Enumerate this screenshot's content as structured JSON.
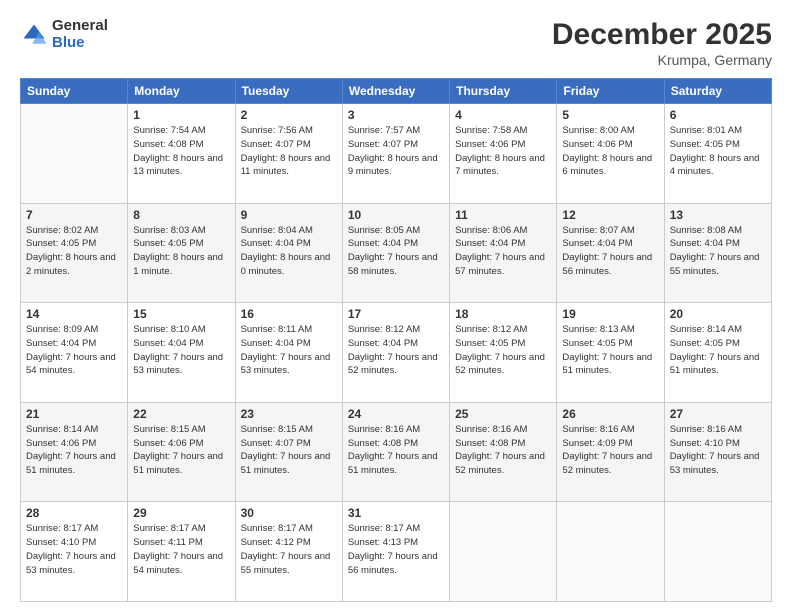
{
  "logo": {
    "general": "General",
    "blue": "Blue"
  },
  "header": {
    "month": "December 2025",
    "location": "Krumpa, Germany"
  },
  "weekdays": [
    "Sunday",
    "Monday",
    "Tuesday",
    "Wednesday",
    "Thursday",
    "Friday",
    "Saturday"
  ],
  "weeks": [
    [
      {
        "day": "",
        "empty": true
      },
      {
        "day": "1",
        "sunrise": "7:54 AM",
        "sunset": "4:08 PM",
        "daylight": "8 hours and 13 minutes."
      },
      {
        "day": "2",
        "sunrise": "7:56 AM",
        "sunset": "4:07 PM",
        "daylight": "8 hours and 11 minutes."
      },
      {
        "day": "3",
        "sunrise": "7:57 AM",
        "sunset": "4:07 PM",
        "daylight": "8 hours and 9 minutes."
      },
      {
        "day": "4",
        "sunrise": "7:58 AM",
        "sunset": "4:06 PM",
        "daylight": "8 hours and 7 minutes."
      },
      {
        "day": "5",
        "sunrise": "8:00 AM",
        "sunset": "4:06 PM",
        "daylight": "8 hours and 6 minutes."
      },
      {
        "day": "6",
        "sunrise": "8:01 AM",
        "sunset": "4:05 PM",
        "daylight": "8 hours and 4 minutes."
      }
    ],
    [
      {
        "day": "7",
        "sunrise": "8:02 AM",
        "sunset": "4:05 PM",
        "daylight": "8 hours and 2 minutes."
      },
      {
        "day": "8",
        "sunrise": "8:03 AM",
        "sunset": "4:05 PM",
        "daylight": "8 hours and 1 minute."
      },
      {
        "day": "9",
        "sunrise": "8:04 AM",
        "sunset": "4:04 PM",
        "daylight": "8 hours and 0 minutes."
      },
      {
        "day": "10",
        "sunrise": "8:05 AM",
        "sunset": "4:04 PM",
        "daylight": "7 hours and 58 minutes."
      },
      {
        "day": "11",
        "sunrise": "8:06 AM",
        "sunset": "4:04 PM",
        "daylight": "7 hours and 57 minutes."
      },
      {
        "day": "12",
        "sunrise": "8:07 AM",
        "sunset": "4:04 PM",
        "daylight": "7 hours and 56 minutes."
      },
      {
        "day": "13",
        "sunrise": "8:08 AM",
        "sunset": "4:04 PM",
        "daylight": "7 hours and 55 minutes."
      }
    ],
    [
      {
        "day": "14",
        "sunrise": "8:09 AM",
        "sunset": "4:04 PM",
        "daylight": "7 hours and 54 minutes."
      },
      {
        "day": "15",
        "sunrise": "8:10 AM",
        "sunset": "4:04 PM",
        "daylight": "7 hours and 53 minutes."
      },
      {
        "day": "16",
        "sunrise": "8:11 AM",
        "sunset": "4:04 PM",
        "daylight": "7 hours and 53 minutes."
      },
      {
        "day": "17",
        "sunrise": "8:12 AM",
        "sunset": "4:04 PM",
        "daylight": "7 hours and 52 minutes."
      },
      {
        "day": "18",
        "sunrise": "8:12 AM",
        "sunset": "4:05 PM",
        "daylight": "7 hours and 52 minutes."
      },
      {
        "day": "19",
        "sunrise": "8:13 AM",
        "sunset": "4:05 PM",
        "daylight": "7 hours and 51 minutes."
      },
      {
        "day": "20",
        "sunrise": "8:14 AM",
        "sunset": "4:05 PM",
        "daylight": "7 hours and 51 minutes."
      }
    ],
    [
      {
        "day": "21",
        "sunrise": "8:14 AM",
        "sunset": "4:06 PM",
        "daylight": "7 hours and 51 minutes."
      },
      {
        "day": "22",
        "sunrise": "8:15 AM",
        "sunset": "4:06 PM",
        "daylight": "7 hours and 51 minutes."
      },
      {
        "day": "23",
        "sunrise": "8:15 AM",
        "sunset": "4:07 PM",
        "daylight": "7 hours and 51 minutes."
      },
      {
        "day": "24",
        "sunrise": "8:16 AM",
        "sunset": "4:08 PM",
        "daylight": "7 hours and 51 minutes."
      },
      {
        "day": "25",
        "sunrise": "8:16 AM",
        "sunset": "4:08 PM",
        "daylight": "7 hours and 52 minutes."
      },
      {
        "day": "26",
        "sunrise": "8:16 AM",
        "sunset": "4:09 PM",
        "daylight": "7 hours and 52 minutes."
      },
      {
        "day": "27",
        "sunrise": "8:16 AM",
        "sunset": "4:10 PM",
        "daylight": "7 hours and 53 minutes."
      }
    ],
    [
      {
        "day": "28",
        "sunrise": "8:17 AM",
        "sunset": "4:10 PM",
        "daylight": "7 hours and 53 minutes."
      },
      {
        "day": "29",
        "sunrise": "8:17 AM",
        "sunset": "4:11 PM",
        "daylight": "7 hours and 54 minutes."
      },
      {
        "day": "30",
        "sunrise": "8:17 AM",
        "sunset": "4:12 PM",
        "daylight": "7 hours and 55 minutes."
      },
      {
        "day": "31",
        "sunrise": "8:17 AM",
        "sunset": "4:13 PM",
        "daylight": "7 hours and 56 minutes."
      },
      {
        "day": "",
        "empty": true
      },
      {
        "day": "",
        "empty": true
      },
      {
        "day": "",
        "empty": true
      }
    ]
  ]
}
